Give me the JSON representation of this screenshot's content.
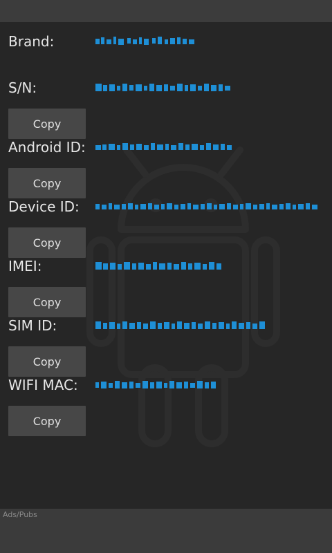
{
  "accent_color": "#1e8fd6",
  "fields": [
    {
      "label": "Brand:",
      "value_icon": "redacted-text",
      "has_copy": false
    },
    {
      "label": "S/N:",
      "value_icon": "redacted-text",
      "has_copy": true
    },
    {
      "label": "Android ID:",
      "value_icon": "redacted-text",
      "has_copy": true
    },
    {
      "label": "Device ID:",
      "value_icon": "redacted-text",
      "has_copy": true
    },
    {
      "label": "IMEI:",
      "value_icon": "redacted-text",
      "has_copy": true
    },
    {
      "label": "SIM ID:",
      "value_icon": "redacted-text",
      "has_copy": true
    },
    {
      "label": "WIFI MAC:",
      "value_icon": "redacted-text",
      "has_copy": true
    }
  ],
  "copy_label": "Copy",
  "watermark_icon": "android-robot-icon",
  "ad": {
    "text": "Ads/Pubs"
  }
}
